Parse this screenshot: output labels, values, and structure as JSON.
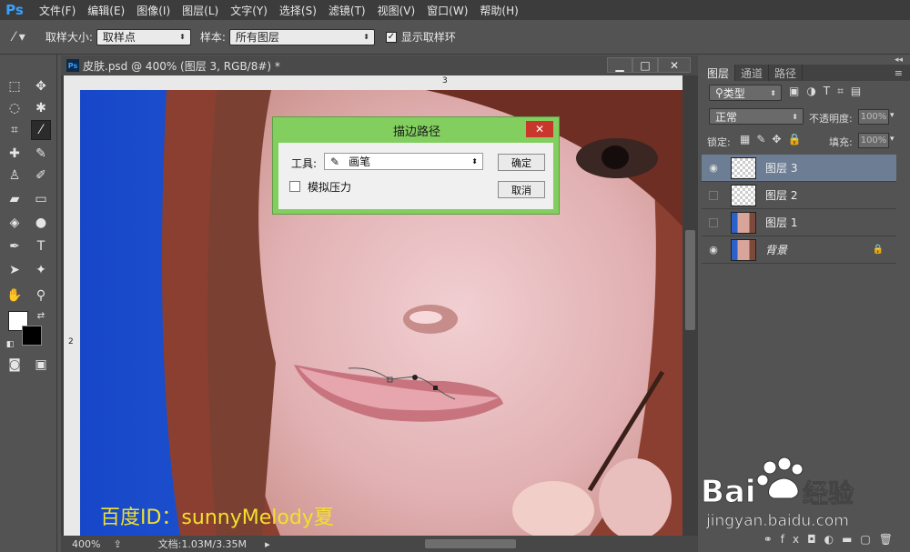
{
  "app": {
    "logo": "Ps"
  },
  "menu": [
    "文件(F)",
    "编辑(E)",
    "图像(I)",
    "图层(L)",
    "文字(Y)",
    "选择(S)",
    "滤镜(T)",
    "视图(V)",
    "窗口(W)",
    "帮助(H)"
  ],
  "options": {
    "sample_size_label": "取样大小:",
    "sample_size_value": "取样点",
    "sample_label": "样本:",
    "sample_value": "所有图层",
    "show_ring_label": "显示取样环"
  },
  "document": {
    "title": "皮肤.psd @ 400% (图层 3, RGB/8#) *",
    "ruler_h_mark": "3",
    "ruler_v_mark": "2",
    "zoom": "400%",
    "doc_info": "文档:1.03M/3.35M"
  },
  "dialog": {
    "title": "描边路径",
    "tool_label": "工具:",
    "tool_value": "画笔",
    "simulate_pressure": "模拟压力",
    "ok": "确定",
    "cancel": "取消",
    "close": "✕"
  },
  "panel": {
    "tabs": [
      "图层",
      "通道",
      "路径"
    ],
    "filter_label": "类型",
    "blend_mode": "正常",
    "opacity_label": "不透明度:",
    "opacity_value": "100%",
    "lock_label": "锁定:",
    "fill_label": "填充:",
    "fill_value": "100%",
    "layers": [
      {
        "name": "图层 3",
        "visible": true,
        "selected": true
      },
      {
        "name": "图层 2",
        "visible": false,
        "selected": false
      },
      {
        "name": "图层 1",
        "visible": false,
        "selected": false
      },
      {
        "name": "背景",
        "visible": true,
        "selected": false
      }
    ]
  },
  "watermark": "百度ID：sunnyMelody夏",
  "baidu": {
    "logo": "Bai",
    "du": "经验",
    "url": "jingyan.baidu.com"
  },
  "colors": {
    "dialog_green": "#82cf5f",
    "close_red": "#c9372c",
    "selected_layer": "#6c7d94",
    "ps_blue": "#3aa1ff",
    "watermark_yellow": "#f2e02b"
  }
}
